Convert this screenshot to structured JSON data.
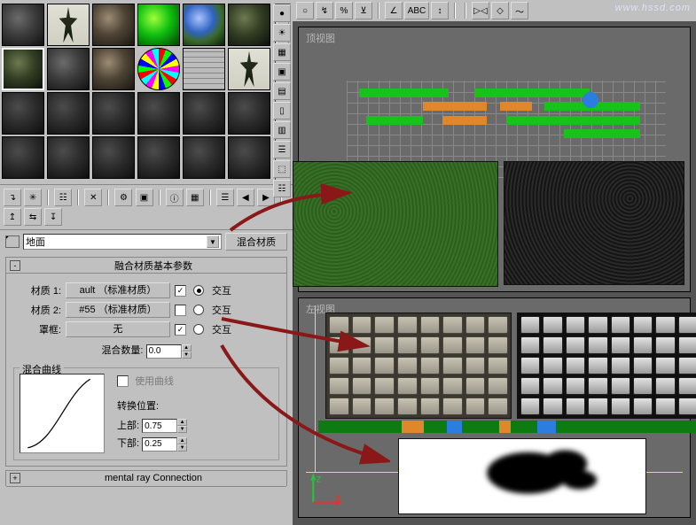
{
  "material_name": "地面",
  "material_type_button": "混合材质",
  "rollouts": {
    "main": {
      "title": "融合材质基本参数",
      "mat1_label": "材质 1:",
      "mat1_value": "ault （标准材质）",
      "mat2_label": "材质 2:",
      "mat2_value": "#55 （标准材质）",
      "mask_label": "罩框:",
      "mask_value": "无",
      "interactive_label": "交互",
      "mix_amount_label": "混合数量:",
      "mix_amount_value": "0.0"
    },
    "curve": {
      "title": "混合曲线",
      "use_curve_label": "使用曲线",
      "transition_label": "转换位置:",
      "upper_label": "上部:",
      "upper_value": "0.75",
      "lower_label": "下部:",
      "lower_value": "0.25"
    },
    "mentalray": {
      "title": "mental ray Connection"
    }
  },
  "viewports": {
    "top_label": "顶视图",
    "bottom_label": "左视图"
  },
  "axis": {
    "z": "z",
    "x": "x"
  },
  "watermark": "www.hssd.com",
  "icons": {
    "circle": "○",
    "percent": "%",
    "magnet": "⊻",
    "flip": "▷◁",
    "eraser": "◇",
    "stroke": "〜",
    "abc": "ABC",
    "sphere": "●",
    "cube": "▣",
    "cyl": "▯",
    "check": "▦",
    "light": "☀",
    "cam": "▥",
    "back": "▤",
    "pick": "↴",
    "new": "✳",
    "del": "✕",
    "navL": "◀",
    "navR": "▶",
    "tree": "☷",
    "opt": "☰",
    "info": "ⓘ",
    "fx": "⚙"
  }
}
